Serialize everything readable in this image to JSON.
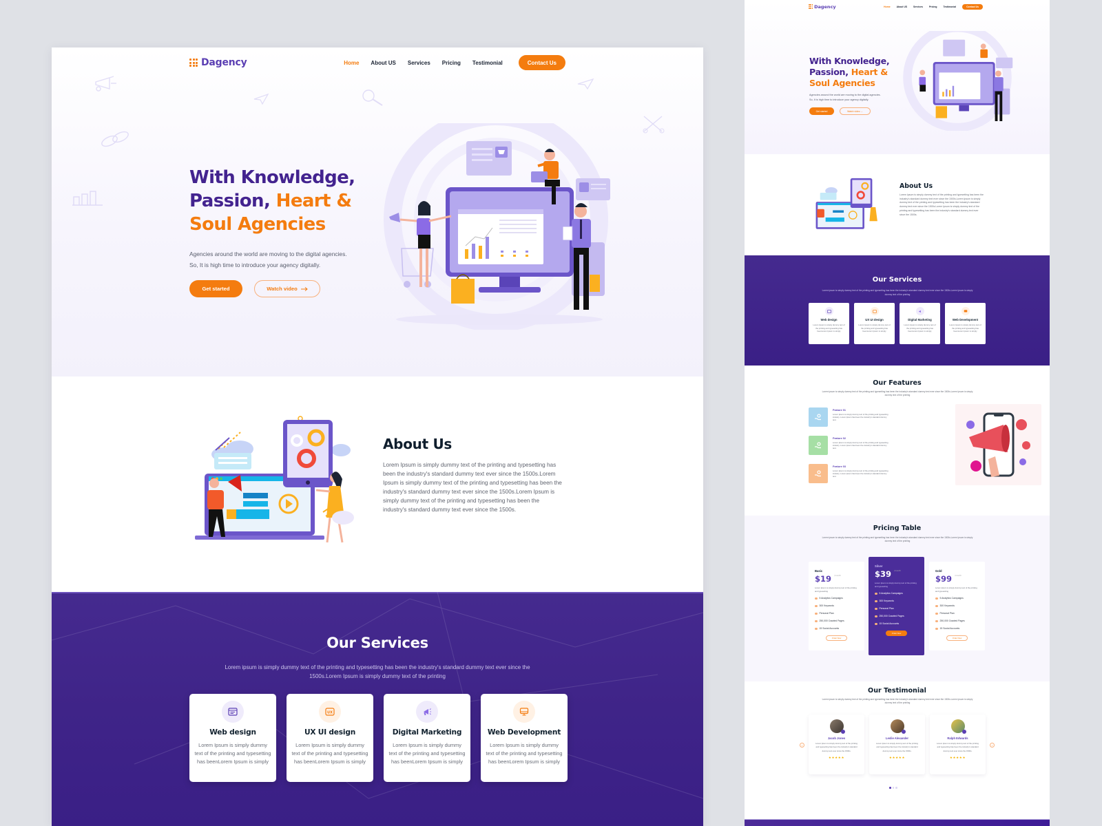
{
  "brand": {
    "name": "Dagency",
    "primary_color": "#43238f",
    "accent_color": "#f47c0f",
    "services_bg": "#3f2488"
  },
  "nav": {
    "items": [
      {
        "label": "Home",
        "active": true
      },
      {
        "label": "About US",
        "active": false
      },
      {
        "label": "Services",
        "active": false
      },
      {
        "label": "Pricing",
        "active": false
      },
      {
        "label": "Testimonial",
        "active": false
      }
    ],
    "cta_label": "Contact Us"
  },
  "hero": {
    "title_line1": "With Knowledge,",
    "title_line2_a": "Passion, ",
    "title_line2_b": "Heart &",
    "title_line3": "Soul Agencies",
    "subtitle_line1": "Agencies around the world are moving to the digital agencies.",
    "subtitle_line2": "So, It is high time to introduce your agency digitally.",
    "primary_button": "Get started",
    "secondary_button": "Watch video",
    "secondary_icon": "arrow-right-icon"
  },
  "about": {
    "title": "About Us",
    "body": "Lorem Ipsum is simply dummy text of the printing and typesetting has been the industry's standard dummy text ever since the 1500s.Lorem Ipsum is simply dummy text of the printing and typesetting has been the industry's standard dummy text ever since the 1500s.Lorem Ipsum is simply dummy text of the printing and typesetting has been the industry's standard dummy text ever since the 1500s."
  },
  "services": {
    "title": "Our Services",
    "subtitle": "Lorem ipsum is simply dummy text of the printing and typesetting has been the industry's standard dummy text ever since the 1500s.Lorem Ipsum is simply dummy text of the printing",
    "cards": [
      {
        "title": "Web design",
        "icon": "browser-window-icon",
        "tone": "purple",
        "text": "Lorem Ipsum is simply dummy text of the printing and typesetting has beenLorem Ipsum is simply"
      },
      {
        "title": "UX UI design",
        "icon": "ux-badge-icon",
        "tone": "orange",
        "text": "Lorem Ipsum is simply dummy text of the printing and typesetting has beenLorem Ipsum is simply"
      },
      {
        "title": "Digital Marketing",
        "icon": "megaphone-icon",
        "tone": "purple",
        "text": "Lorem Ipsum is simply dummy text of the printing and typesetting has beenLorem Ipsum is simply"
      },
      {
        "title": "Web Development",
        "icon": "monitor-icon",
        "tone": "orange",
        "text": "Lorem Ipsum is simply dummy text of the printing and typesetting has beenLorem Ipsum is simply"
      }
    ]
  },
  "features": {
    "title": "Our Features",
    "subtitle": "Lorem ipsum is simply dummy text of the printing and typesetting has been the industry's standard dummy text ever since the 1500s.Lorem Ipsum is simply dummy text of the printing",
    "items": [
      {
        "title": "Feature 01",
        "color": "#a9d6f0",
        "text": "Lorem Ipsum is simply dummy text of the printing and typesetting industry. Lorem Ipsum has been the industry's standard dummy text."
      },
      {
        "title": "Feature 02",
        "color": "#a6dfa5",
        "text": "Lorem Ipsum is simply dummy text of the printing and typesetting industry. Lorem Ipsum has been the industry's standard dummy text."
      },
      {
        "title": "Feature 03",
        "color": "#f9bd8c",
        "text": "Lorem Ipsum is simply dummy text of the printing and typesetting industry. Lorem Ipsum has been the industry's standard dummy text."
      }
    ]
  },
  "pricing": {
    "title": "Pricing Table",
    "subtitle": "Lorem ipsum is simply dummy text of the printing and typesetting has been the industry's standard dummy text ever since the 1500s.Lorem Ipsum is simply dummy text of the printing",
    "period": "/month",
    "plans": [
      {
        "name": "Basic",
        "price": "$19",
        "featured": false,
        "desc": "Lorem Ipsum is simply dummy text of the printing and typesetting",
        "features": [
          "5 Analytics Campaigns",
          "300 Keywords",
          "Personal Plan",
          "250,000 Crawled Pages",
          "15 Social Accounts"
        ],
        "button": "Order Now"
      },
      {
        "name": "Silver",
        "price": "$39",
        "featured": true,
        "desc": "Lorem Ipsum is simply dummy text of the printing and typesetting",
        "features": [
          "5 Analytics Campaigns",
          "300 Keywords",
          "Personal Plan",
          "250,000 Crawled Pages",
          "15 Social Accounts"
        ],
        "button": "Order Now"
      },
      {
        "name": "Gold",
        "price": "$99",
        "featured": false,
        "desc": "Lorem Ipsum is simply dummy text of the printing and typesetting",
        "features": [
          "5 Analytics Campaigns",
          "300 Keywords",
          "Personal Plan",
          "250,000 Crawled Pages",
          "15 Social Accounts"
        ],
        "button": "Order Now"
      }
    ]
  },
  "testimonials": {
    "title": "Our Testimonial",
    "subtitle": "Lorem ipsum is simply dummy text of the printing and typesetting has been the industry's standard dummy text ever since the 1500s.Lorem Ipsum is simply dummy text of the printing",
    "items": [
      {
        "name": "Jacob Jones",
        "text": "Lorem Ipsum is simply dummy text of the printing and typesetting has been the industry's standard dummy text ever since the 1500s.",
        "stars": "★★★★★",
        "rating": 5
      },
      {
        "name": "Leslie Alexander",
        "text": "Lorem Ipsum is simply dummy text of the printing and typesetting has been the industry's standard dummy text ever since the 1500s.",
        "stars": "★★★★★",
        "rating": 5
      },
      {
        "name": "Ralph Edwards",
        "text": "Lorem Ipsum is simply dummy text of the printing and typesetting has been the industry's standard dummy text ever since the 1500s.",
        "stars": "★★★★★",
        "rating": 5
      }
    ],
    "prev_icon": "arrow-left-icon",
    "next_icon": "arrow-right-icon",
    "pages": 3,
    "current_page": 1
  }
}
